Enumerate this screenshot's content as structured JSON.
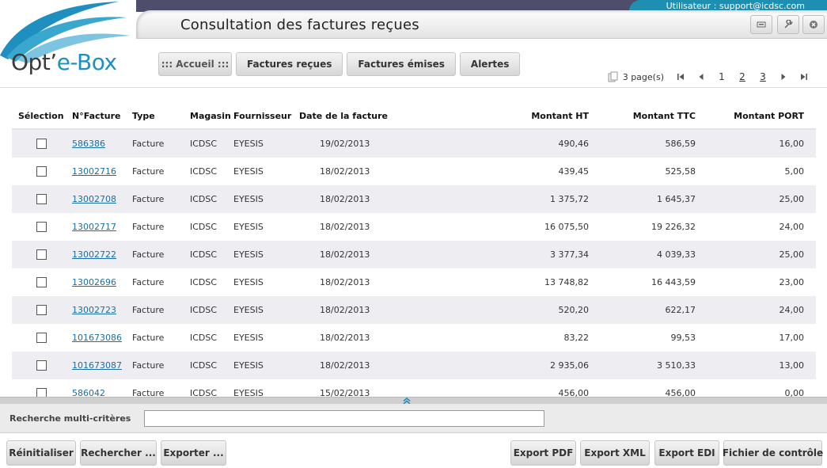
{
  "header": {
    "logo_main": "Opt’",
    "logo_accent": "e-Box",
    "user_label": "Utilisateur : support@icdsc.com",
    "title": "Consultation des factures reçues"
  },
  "nav": {
    "home": "::: Accueil :::",
    "received": "Factures reçues",
    "issued": "Factures émises",
    "alerts": "Alertes"
  },
  "pager": {
    "pages_text": "3 page(s)",
    "current": "1",
    "page2": "2",
    "page3": "3"
  },
  "table": {
    "headers": {
      "selection": "Sélection",
      "number": "N°Facture",
      "type": "Type",
      "store": "Magasin",
      "supplier": "Fournisseur",
      "date": "Date de la facture",
      "ht": "Montant HT",
      "ttc": "Montant TTC",
      "port": "Montant PORT"
    },
    "rows": [
      {
        "number": "586386",
        "type": "Facture",
        "store": "ICDSC",
        "supplier": "EYESIS",
        "date": "19/02/2013",
        "ht": "490,46",
        "ttc": "586,59",
        "port": "16,00"
      },
      {
        "number": "13002716",
        "type": "Facture",
        "store": "ICDSC",
        "supplier": "EYESIS",
        "date": "18/02/2013",
        "ht": "439,45",
        "ttc": "525,58",
        "port": "5,00"
      },
      {
        "number": "13002708",
        "type": "Facture",
        "store": "ICDSC",
        "supplier": "EYESIS",
        "date": "18/02/2013",
        "ht": "1 375,72",
        "ttc": "1 645,37",
        "port": "25,00"
      },
      {
        "number": "13002717",
        "type": "Facture",
        "store": "ICDSC",
        "supplier": "EYESIS",
        "date": "18/02/2013",
        "ht": "16 075,50",
        "ttc": "19 226,32",
        "port": "24,00"
      },
      {
        "number": "13002722",
        "type": "Facture",
        "store": "ICDSC",
        "supplier": "EYESIS",
        "date": "18/02/2013",
        "ht": "3 377,34",
        "ttc": "4 039,33",
        "port": "25,00"
      },
      {
        "number": "13002696",
        "type": "Facture",
        "store": "ICDSC",
        "supplier": "EYESIS",
        "date": "18/02/2013",
        "ht": "13 748,82",
        "ttc": "16 443,59",
        "port": "23,00"
      },
      {
        "number": "13002723",
        "type": "Facture",
        "store": "ICDSC",
        "supplier": "EYESIS",
        "date": "18/02/2013",
        "ht": "520,20",
        "ttc": "622,17",
        "port": "24,00"
      },
      {
        "number": "101673086",
        "type": "Facture",
        "store": "ICDSC",
        "supplier": "EYESIS",
        "date": "18/02/2013",
        "ht": "83,22",
        "ttc": "99,53",
        "port": "17,00"
      },
      {
        "number": "101673087",
        "type": "Facture",
        "store": "ICDSC",
        "supplier": "EYESIS",
        "date": "18/02/2013",
        "ht": "2 935,06",
        "ttc": "3 510,33",
        "port": "13,00"
      },
      {
        "number": "586042",
        "type": "Facture",
        "store": "ICDSC",
        "supplier": "EYESIS",
        "date": "15/02/2013",
        "ht": "456,00",
        "ttc": "456,00",
        "port": "0,00"
      }
    ]
  },
  "search": {
    "label": "Recherche multi-critères",
    "value": ""
  },
  "footer": {
    "reset": "Réinitialiser",
    "search": "Rechercher ...",
    "export": "Exporter ...",
    "export_pdf": "Export PDF",
    "export_xml": "Export XML",
    "export_edi": "Export EDI",
    "control_file": "Fichier de contrôle"
  },
  "colors": {
    "brand_blue": "#1f8fc0",
    "header_strip": "#4f4d6c",
    "row_alt": "#eeeef2"
  }
}
